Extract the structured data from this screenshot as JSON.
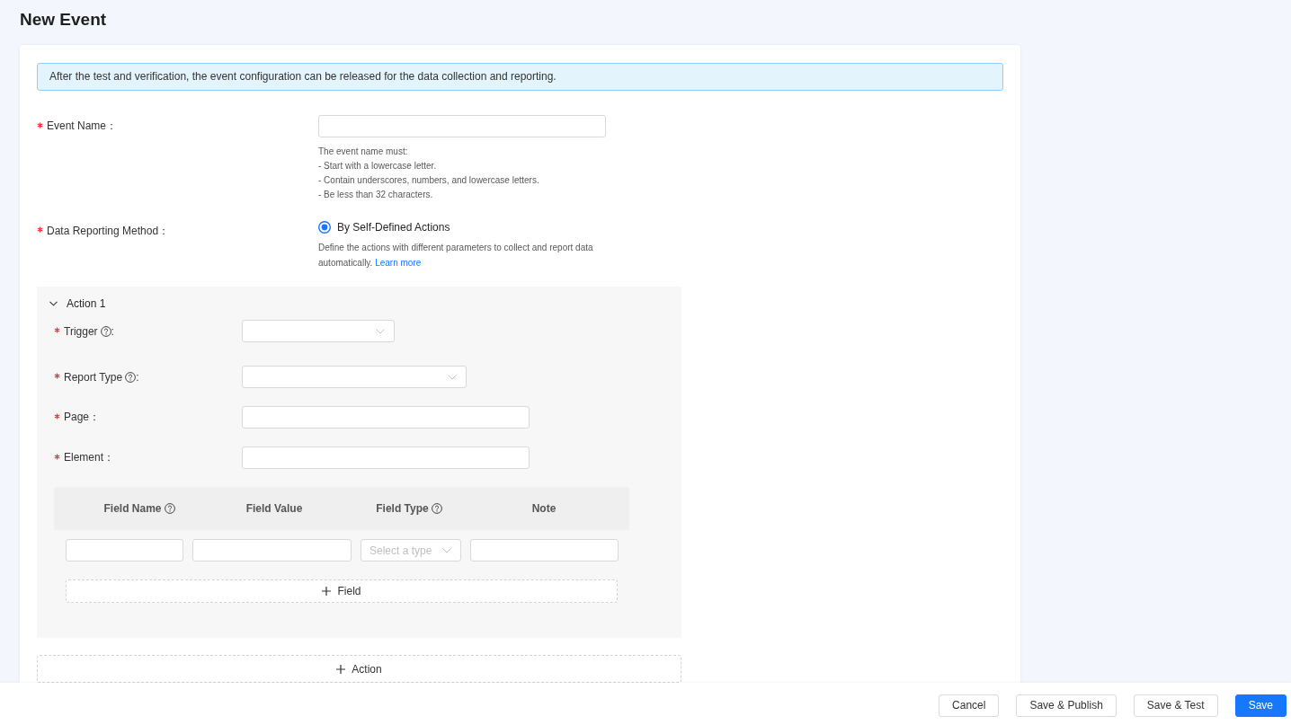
{
  "page": {
    "title": "New Event"
  },
  "alert": {
    "text": "After the test and verification, the event configuration can be released for the data collection and reporting."
  },
  "form": {
    "event_name": {
      "label": "Event Name：",
      "required": true,
      "hint_lines": [
        "The event name must:",
        "- Start with a lowercase letter.",
        "- Contain underscores, numbers, and lowercase letters.",
        "- Be less than 32 characters."
      ]
    },
    "data_reporting_method": {
      "label": "Data Reporting Method：",
      "required": true,
      "options": [
        {
          "label": "By Self-Defined Actions",
          "selected": true
        }
      ],
      "description": "Define the actions with different parameters to collect and report data automatically.",
      "link": "Learn more"
    }
  },
  "actions": [
    {
      "title": "Action 1",
      "expanded": true,
      "fields": [
        {
          "label": "Trigger",
          "suffix": ":",
          "required": true,
          "help": true,
          "kind": "select"
        },
        {
          "label": "Report Type",
          "suffix": ":",
          "required": true,
          "help": true,
          "kind": "select"
        },
        {
          "label": "Page：",
          "required": true,
          "help": false,
          "kind": "input"
        },
        {
          "label": "Element：",
          "required": true,
          "help": false,
          "kind": "input"
        }
      ],
      "table": {
        "columns": [
          {
            "label": "Field Name",
            "help": true
          },
          {
            "label": "Field Value",
            "help": false
          },
          {
            "label": "Field Type",
            "help": true
          },
          {
            "label": "Note",
            "help": false
          }
        ],
        "rows": [
          {
            "cells": [
              {
                "kind": "input"
              },
              {
                "kind": "input"
              },
              {
                "kind": "select",
                "placeholder": "Select a type"
              },
              {
                "kind": "input"
              }
            ]
          }
        ]
      },
      "add_field_button": "Field"
    }
  ],
  "add_action_button": "Action",
  "footer": {
    "buttons": [
      {
        "label": "Cancel",
        "kind": "default"
      },
      {
        "label": "Save & Publish",
        "kind": "default"
      },
      {
        "label": "Save & Test",
        "kind": "default"
      },
      {
        "label": "Save",
        "kind": "primary"
      }
    ]
  }
}
